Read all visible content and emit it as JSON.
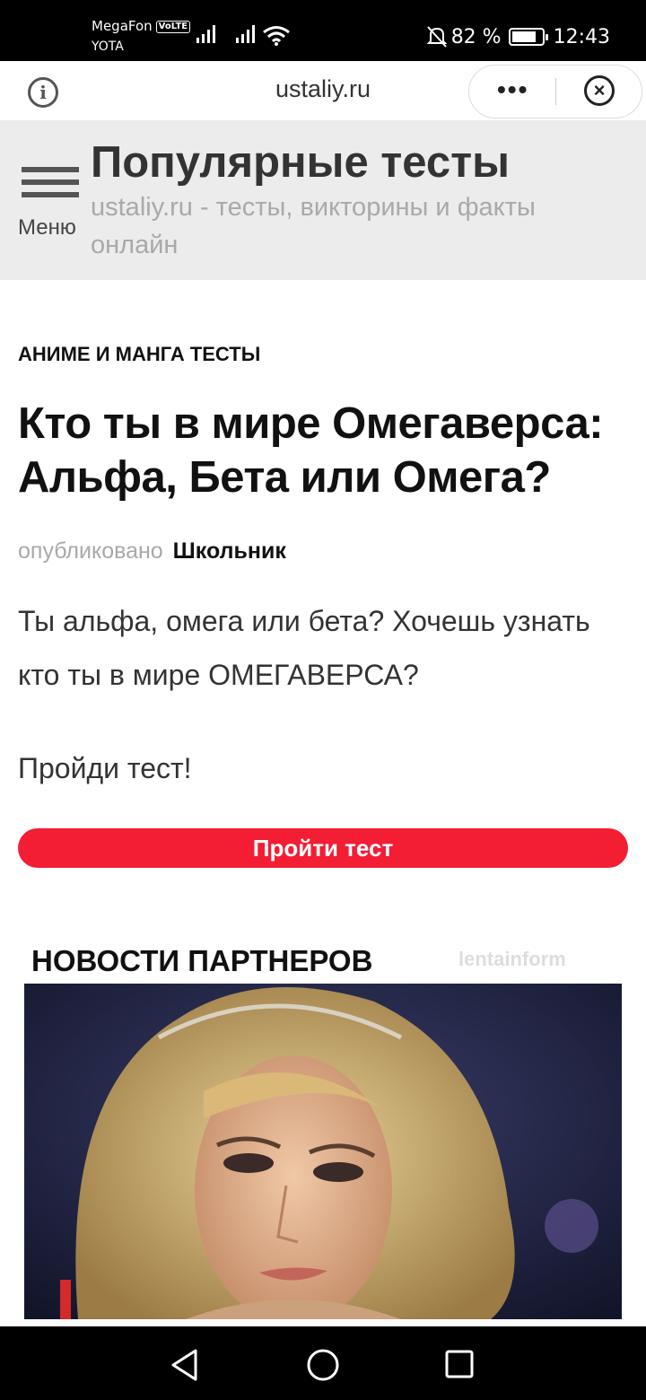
{
  "status_bar": {
    "carrier1": "MegaFon",
    "volte": "VoLTE",
    "carrier2": "YOTA",
    "battery_text": "82 %",
    "battery_level": 0.82,
    "time": "12:43"
  },
  "browser": {
    "url": "ustaliy.ru"
  },
  "header": {
    "menu_label": "Меню",
    "title": "Популярные тесты",
    "subtitle": "ustaliy.ru - тесты, викторины и факты онлайн"
  },
  "article": {
    "category": "АНИМЕ И МАНГА ТЕСТЫ",
    "title": "Кто ты в мире Омегаверса: Альфа, Бета или Омега?",
    "byline_prefix": "опубликовано",
    "author": "Школьник",
    "intro": "Ты альфа, омега или бета? Хочешь узнать кто ты в мире ОМЕГАВЕРСА?",
    "cta": "Пройди тест!",
    "start_button": "Пройти тест"
  },
  "partners": {
    "title": "НОВОСТИ ПАРТНЕРОВ",
    "brand": "lentainform"
  },
  "icons": {
    "info": "info-icon",
    "more": "more-icon",
    "close": "close-icon",
    "menu": "hamburger-icon",
    "back": "back-icon",
    "home": "home-icon",
    "recents": "recents-icon"
  },
  "colors": {
    "accent": "#f31d34",
    "header_bg": "#ececec"
  }
}
